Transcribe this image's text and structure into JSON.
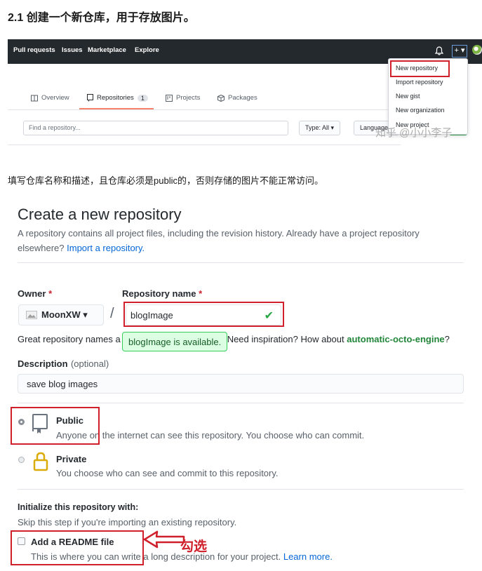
{
  "article": {
    "heading": "2.1 创建一个新仓库，用于存放图片。",
    "paragraph": "填写仓库名称和描述，且仓库必须是public的，否则存储的图片不能正常访问。",
    "watermark": "知乎 @小小李子",
    "annotation": "勾选"
  },
  "github": {
    "nav": [
      "Pull requests",
      "Issues",
      "Marketplace",
      "Explore"
    ],
    "plus_label": "+ ▾",
    "tabs": [
      {
        "label": "Overview",
        "icon": "book-icon"
      },
      {
        "label": "Repositories",
        "icon": "repo-icon",
        "count": "1"
      },
      {
        "label": "Projects",
        "icon": "project-icon"
      },
      {
        "label": "Packages",
        "icon": "package-icon"
      }
    ],
    "find_placeholder": "Find a repository...",
    "type_filter": "Type: All ▾",
    "language_filter": "Language ▾",
    "dropdown": [
      "New repository",
      "Import repository",
      "New gist",
      "New organization",
      "New project"
    ],
    "highlight_color": "#d0202b"
  },
  "create": {
    "title": "Create a new repository",
    "description": "A repository contains all project files, including the revision history. Already have a project repository elsewhere?",
    "import_link": "Import a repository.",
    "owner_label": "Owner",
    "repo_label": "Repository name",
    "required_mark": "*",
    "owner_value": "MoonXW ▾",
    "slash": "/",
    "repo_value": "blogImage",
    "check_mark": "✔",
    "hint_prefix": "Great repository names a",
    "hint_suffix": "Need inspiration? How about",
    "suggestion": "automatic-octo-engine",
    "hint_end": "?",
    "tooltip": "blogImage is available.",
    "desc_label": "Description",
    "desc_optional": "(optional)",
    "desc_value": "save blog images",
    "public_title": "Public",
    "public_desc": "Anyone on the internet can see this repository. You choose who can commit.",
    "private_title": "Private",
    "private_desc": "You choose who can see and commit to this repository.",
    "init_title": "Initialize this repository with:",
    "init_desc": "Skip this step if you're importing an existing repository.",
    "readme_title": "Add a README file",
    "readme_desc": "This is where you can write a long description for your project.",
    "learn_more": "Learn more."
  }
}
